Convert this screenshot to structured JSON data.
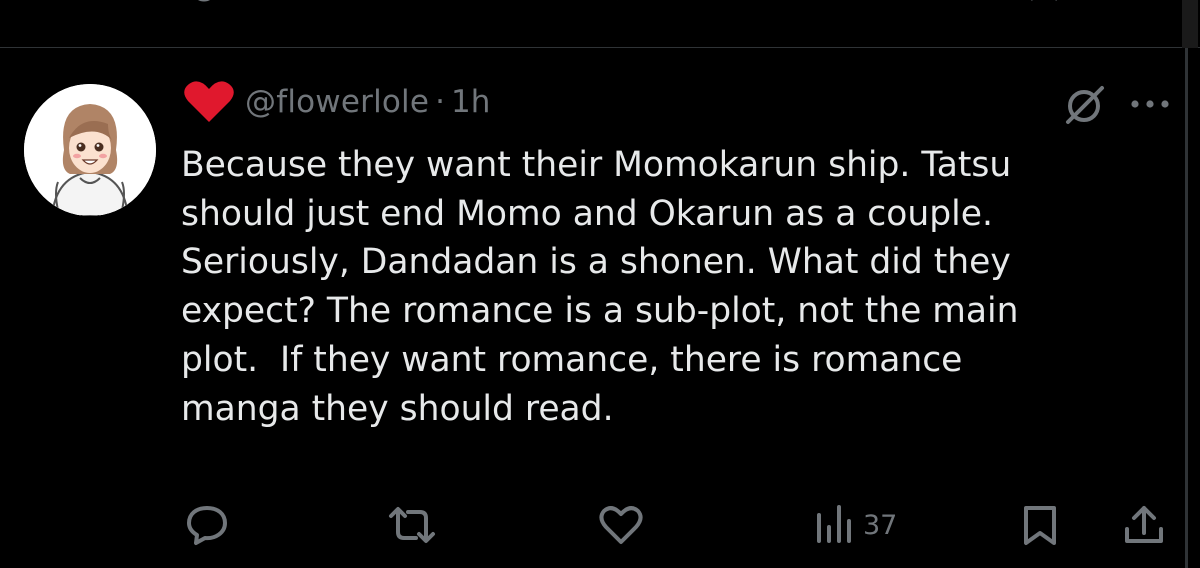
{
  "post": {
    "author_badge": "heart-emoji",
    "handle": "@flowerlole",
    "separator": "·",
    "time": "1h",
    "text": "Because they want their Momokarun ship. Tatsu\nshould just end Momo and Okarun as a couple.\nSeriously, Dandadan is a shonen. What did they\nexpect? The romance is a sub-plot, not the main\nplot.  If they want romance, there is romance\nmanga they should read.",
    "views": "37"
  },
  "colors": {
    "background": "#000000",
    "text": "#e7e9ea",
    "muted": "#71767b",
    "divider": "#2f3336",
    "heart": "#e0182d"
  }
}
